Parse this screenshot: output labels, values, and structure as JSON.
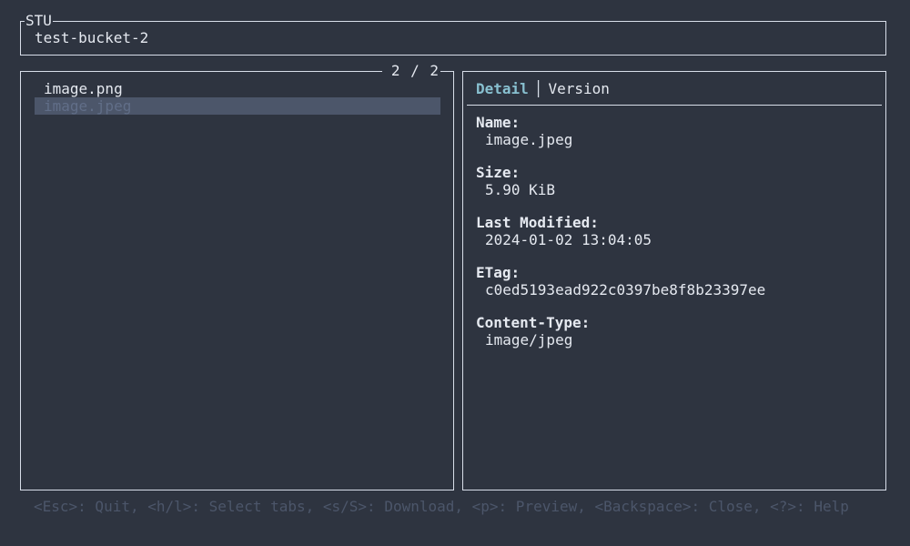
{
  "header": {
    "app_title": "STU",
    "bucket_name": "test-bucket-2"
  },
  "object_list": {
    "counter": "2 / 2",
    "items": [
      {
        "name": "image.png",
        "selected": false
      },
      {
        "name": "image.jpeg",
        "selected": true
      }
    ]
  },
  "detail": {
    "tabs": [
      {
        "label": "Detail",
        "active": true
      },
      {
        "label": "Version",
        "active": false
      }
    ],
    "fields": [
      {
        "label": "Name:",
        "value": "image.jpeg"
      },
      {
        "label": "Size:",
        "value": "5.90 KiB"
      },
      {
        "label": "Last Modified:",
        "value": "2024-01-02 13:04:05"
      },
      {
        "label": "ETag:",
        "value": "c0ed5193ead922c0397be8f8b23397ee"
      },
      {
        "label": "Content-Type:",
        "value": "image/jpeg"
      }
    ]
  },
  "footer": {
    "help_text": "<Esc>: Quit, <h/l>: Select tabs, <s/S>: Download, <p>: Preview, <Backspace>: Close, <?>: Help"
  },
  "colors": {
    "background": "#2e3440",
    "foreground": "#e5e9f0",
    "accent": "#88c0d0",
    "selection_bg": "#4c566a",
    "selection_fg": "#616e88",
    "muted": "#4c566a"
  }
}
